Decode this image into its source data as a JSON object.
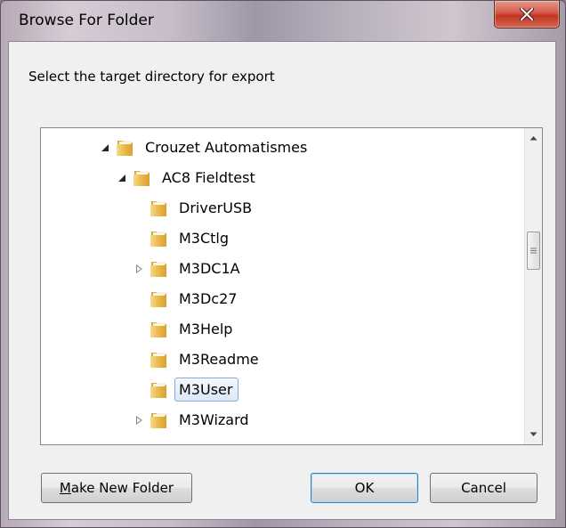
{
  "window": {
    "title": "Browse For Folder"
  },
  "dialog": {
    "prompt": "Select the target directory for export"
  },
  "tree": {
    "items": [
      {
        "label": "Crouzet Automatismes",
        "expander": "expanded"
      },
      {
        "label": "AC8 Fieldtest",
        "expander": "expanded"
      },
      {
        "label": "DriverUSB",
        "expander": "none"
      },
      {
        "label": "M3Ctlg",
        "expander": "none"
      },
      {
        "label": "M3DC1A",
        "expander": "collapsed"
      },
      {
        "label": "M3Dc27",
        "expander": "none"
      },
      {
        "label": "M3Help",
        "expander": "none"
      },
      {
        "label": "M3Readme",
        "expander": "none"
      },
      {
        "label": "M3User",
        "expander": "none",
        "selected": true
      },
      {
        "label": "M3Wizard",
        "expander": "collapsed"
      }
    ]
  },
  "buttons": {
    "make_new_folder_prefix": "M",
    "make_new_folder_rest": "ake New Folder",
    "ok": "OK",
    "cancel": "Cancel"
  },
  "colors": {
    "selection_border": "#84acdd",
    "close_button": "#c1341f"
  },
  "icons": [
    "close-icon",
    "folder-icon",
    "expanded-triangle-icon",
    "collapsed-triangle-icon",
    "scroll-up-icon",
    "scroll-down-icon",
    "size-grip-icon"
  ]
}
